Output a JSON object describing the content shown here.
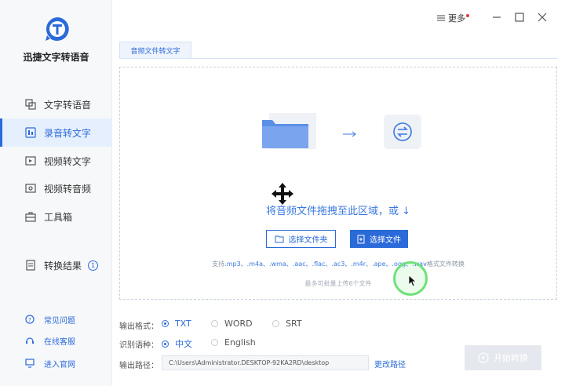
{
  "app": {
    "title": "迅捷文字转语音"
  },
  "sidebar": {
    "items": [
      {
        "label": "文字转语音",
        "active": false
      },
      {
        "label": "录音转文字",
        "active": true
      },
      {
        "label": "视频转文字",
        "active": false
      },
      {
        "label": "视频转音频",
        "active": false
      },
      {
        "label": "工具箱",
        "active": false
      }
    ],
    "result": {
      "label": "转换结果",
      "count": "1"
    },
    "footer": [
      {
        "label": "常见问题"
      },
      {
        "label": "在线客服"
      },
      {
        "label": "进入官网"
      }
    ]
  },
  "topbar": {
    "more_label": "更多"
  },
  "tab": {
    "label": "音频文件转文字"
  },
  "dropzone": {
    "instruction": "将音频文件拖拽至此区域，或 ↓",
    "select_folder": "选择文件夹",
    "select_file": "选择文件",
    "support_prefix": "支持",
    "formats": ".mp3、.m4a、.wma、.aac、.flac、.ac3、.m4r、.ape、.ogg、.wav",
    "support_suffix": "格式文件转换",
    "limit": "最多可批量上传6个文件"
  },
  "options": {
    "format_label": "输出格式：",
    "formats": [
      {
        "label": "TXT",
        "selected": true
      },
      {
        "label": "WORD",
        "selected": false
      },
      {
        "label": "SRT",
        "selected": false
      }
    ],
    "lang_label": "识别语种：",
    "langs": [
      {
        "label": "中文",
        "selected": true
      },
      {
        "label": "English",
        "selected": false
      }
    ],
    "path_label": "输出路径：",
    "path_value": "C:\\Users\\Administrator.DESKTOP-92KA2RD\\desktop",
    "change_path": "更改路径",
    "start_button": "开始转换"
  },
  "colors": {
    "accent": "#2b6ad9",
    "sidebar_bg": "#f7f8fa",
    "active_bg": "#e6effd"
  }
}
